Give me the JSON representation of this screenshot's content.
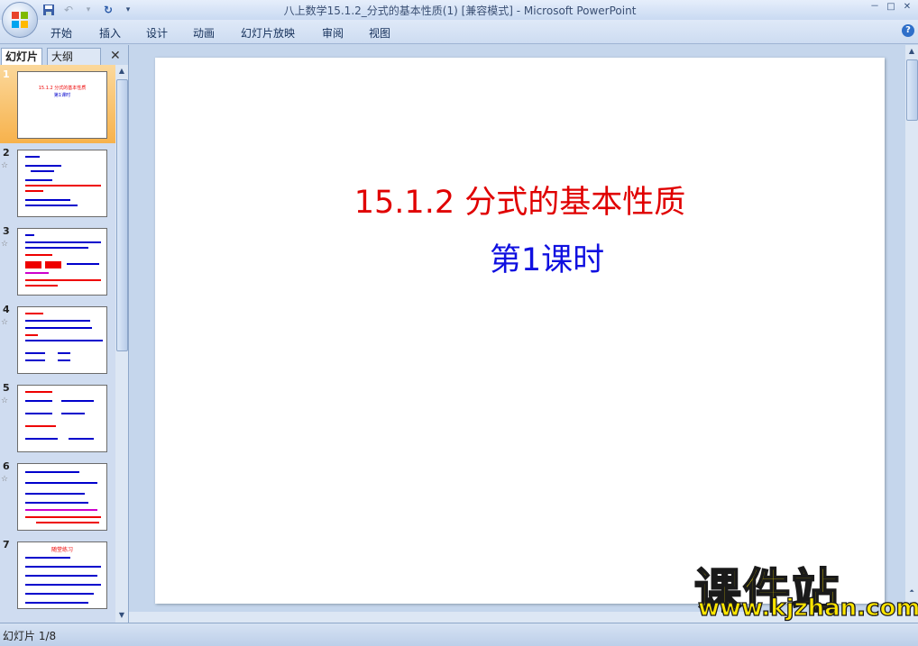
{
  "window": {
    "title": "八上数学15.1.2_分式的基本性质(1) [兼容模式] - Microsoft PowerPoint",
    "controls": [
      "－",
      "□",
      "✕"
    ]
  },
  "quick_access": {
    "icons": [
      "save-icon",
      "undo-icon",
      "redo-icon",
      "customize-icon"
    ]
  },
  "ribbon": {
    "tabs": [
      "开始",
      "插入",
      "设计",
      "动画",
      "幻灯片放映",
      "审阅",
      "视图"
    ],
    "help": "?"
  },
  "left_panel": {
    "tab_slides": "幻灯片",
    "tab_outline": "大纲",
    "close": "✕"
  },
  "thumbnails": [
    {
      "num": "1",
      "selected": true,
      "line1": "15.1.2  分式的基本性质",
      "line2": "第1课时"
    },
    {
      "num": "2",
      "selected": false
    },
    {
      "num": "3",
      "selected": false
    },
    {
      "num": "4",
      "selected": false
    },
    {
      "num": "5",
      "selected": false
    },
    {
      "num": "6",
      "selected": false
    },
    {
      "num": "7",
      "selected": false,
      "line1": "随堂练习"
    }
  ],
  "slide": {
    "title": "15.1.2   分式的基本性质",
    "subtitle": "第1课时",
    "title_color": "#e00000",
    "subtitle_color": "#1010e0"
  },
  "status": {
    "slide_indicator": "幻灯片 1/8"
  },
  "watermark": {
    "line1": "课件站",
    "line2": "www.kjzhan.com"
  }
}
